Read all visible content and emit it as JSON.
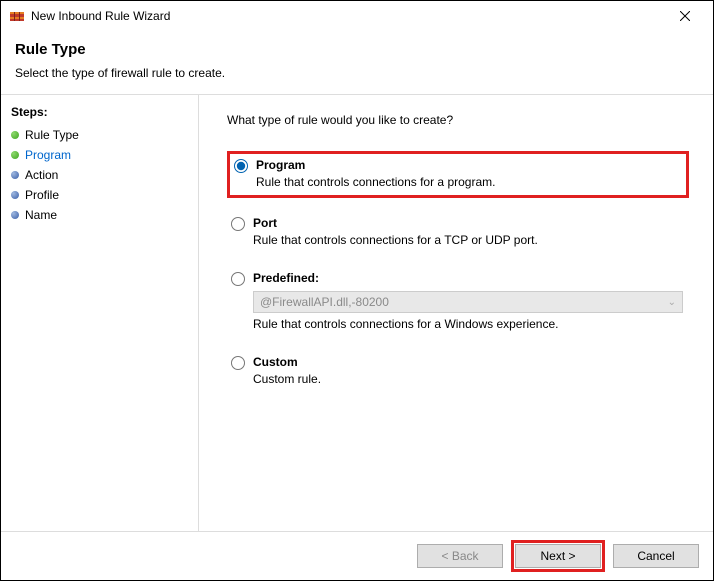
{
  "window": {
    "title": "New Inbound Rule Wizard"
  },
  "header": {
    "heading": "Rule Type",
    "subtitle": "Select the type of firewall rule to create."
  },
  "sidebar": {
    "title": "Steps:",
    "items": [
      {
        "label": "Rule Type"
      },
      {
        "label": "Program"
      },
      {
        "label": "Action"
      },
      {
        "label": "Profile"
      },
      {
        "label": "Name"
      }
    ]
  },
  "content": {
    "prompt": "What type of rule would you like to create?",
    "options": [
      {
        "label": "Program",
        "desc": "Rule that controls connections for a program."
      },
      {
        "label": "Port",
        "desc": "Rule that controls connections for a TCP or UDP port."
      },
      {
        "label": "Predefined:",
        "desc": "Rule that controls connections for a Windows experience.",
        "dropdown": "@FirewallAPI.dll,-80200"
      },
      {
        "label": "Custom",
        "desc": "Custom rule."
      }
    ]
  },
  "footer": {
    "back": "< Back",
    "next": "Next >",
    "cancel": "Cancel"
  }
}
